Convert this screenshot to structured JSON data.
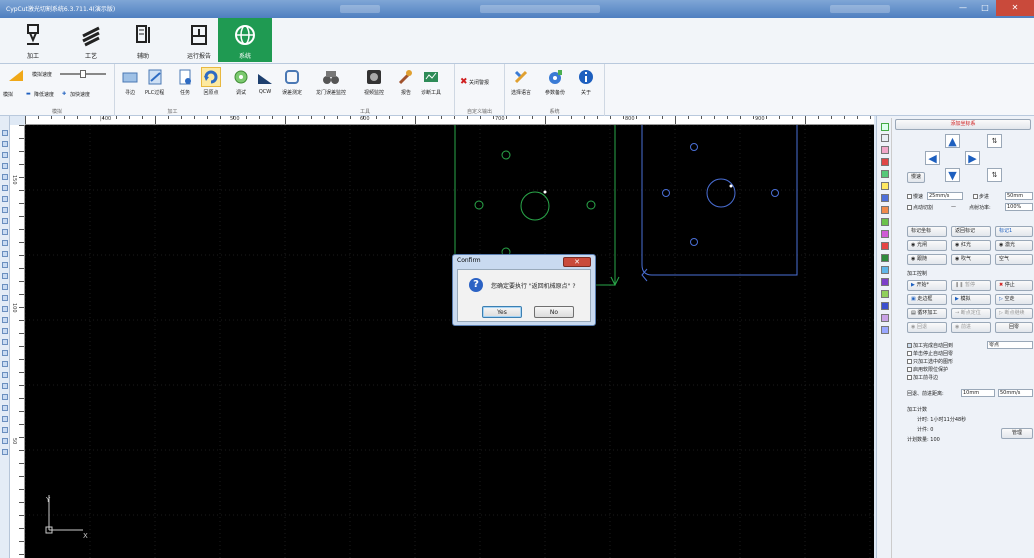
{
  "app": {
    "title": "CypCut激光切割系统6.3.711.4(演示版)"
  },
  "main_tabs": [
    {
      "label": "加工",
      "icon": "laser-head-icon"
    },
    {
      "label": "工艺",
      "icon": "layers-icon"
    },
    {
      "label": "辅助",
      "icon": "tools-icon"
    },
    {
      "label": "运行报告",
      "icon": "report-icon"
    },
    {
      "label": "系统",
      "icon": "globe-icon",
      "active": true
    }
  ],
  "ribbon": {
    "speed": {
      "sim_speed": "模拟速度",
      "sim": "模拟",
      "reduce": "降低速度",
      "increase": "加快速度",
      "group": "模拟"
    },
    "machining": {
      "items": [
        "寻边",
        "PLC过程",
        "任务",
        "回原点",
        "调试",
        "QCW",
        "误差测定",
        "龙门误差监控",
        "视频监控",
        "报告",
        "诊断工具"
      ],
      "group": "加工",
      "tools_group": "工具"
    },
    "custom": {
      "laser_off": "关闭警报",
      "group": "自定义输出"
    },
    "system": {
      "items": [
        "选择语言",
        "参数备份",
        "关于"
      ],
      "group": "系统"
    }
  },
  "rulers": {
    "top": [
      "|400",
      "500",
      "600",
      "700",
      "800",
      "900"
    ],
    "left": [
      "150",
      "100",
      "50"
    ]
  },
  "dialog": {
    "title": "Confirm",
    "message": "您确定要执行 \"返回机械原点\" ?",
    "yes": "Yes",
    "no": "No"
  },
  "canvas": {
    "axis_y": "Y",
    "axis_x": "X"
  },
  "panel": {
    "coord_title": "添加坐标系",
    "slow": "慢速",
    "step_label": "步进",
    "step_value": "50mm",
    "speed_value": "25mm/s",
    "spot_cut": "点动切割",
    "dash": "—",
    "spot_power_label": "点射功率:",
    "spot_power": "100%",
    "mark": "标记坐标",
    "return_mark": "返回标记",
    "mark1": "标记1",
    "light": "光闸",
    "red": "红光",
    "laser": "激光",
    "follow": "跟随",
    "blow": "吹气",
    "air": "空气",
    "control": "加工控制",
    "start": "开始*",
    "pause": "暂停",
    "stop": "停止",
    "frame": "走边框",
    "simulate": "模拟",
    "dry_run": "空走",
    "loop": "循环加工",
    "breakpoint": "断点定位",
    "breakpoint_go": "断点继续",
    "back": "回退",
    "forward": "前进",
    "return": "回零",
    "chk": [
      "加工完成自动回到",
      "单击停止自动回零",
      "只加工选中的图形",
      "启用软限位保护",
      "加工前寻边"
    ],
    "return_target": "零点",
    "retreat_label": "回退、前进距离:",
    "retreat": "10mm",
    "retreat_speed": "50mm/s",
    "count_title": "加工计数",
    "timer": "计时: 1小时11分48秒",
    "pieces": "计件: 0",
    "plan": "计划数量: 100",
    "manage": "管理"
  }
}
